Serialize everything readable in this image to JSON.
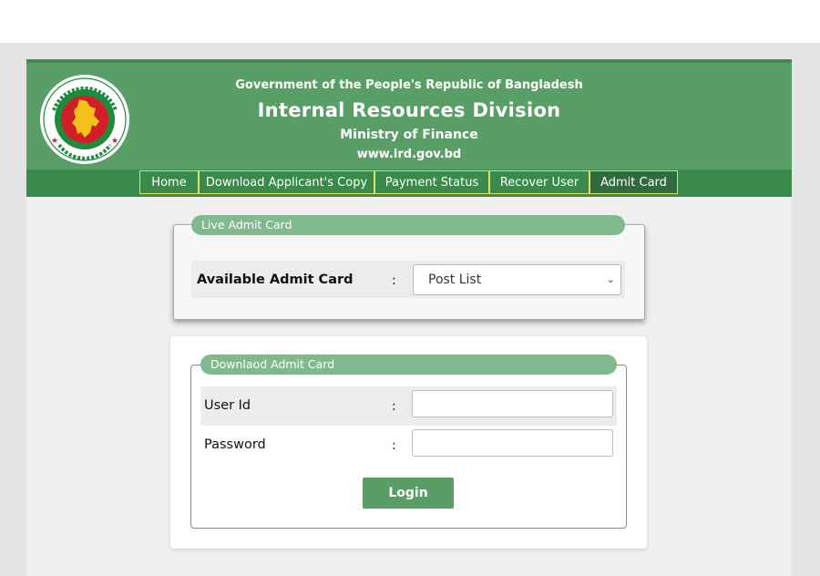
{
  "header": {
    "line1": "Government of the People's Republic of Bangladesh",
    "title": "Internal Resources Division",
    "ministry": "Ministry of Finance",
    "website": "www.ird.gov.bd"
  },
  "nav": {
    "items": [
      {
        "label": "Home"
      },
      {
        "label": "Download Applicant's Copy"
      },
      {
        "label": "Payment Status"
      },
      {
        "label": "Recover User"
      },
      {
        "label": "Admit Card",
        "active": true
      }
    ]
  },
  "live_admit": {
    "legend": "Live Admit Card",
    "field_label": "Available Admit Card",
    "colon": ":",
    "select_value": "Post List"
  },
  "download_admit": {
    "legend": "Downlaod Admit Card",
    "user_id_label": "User Id",
    "password_label": "Password",
    "colon": ":",
    "user_id_value": "",
    "password_value": "",
    "login_label": "Login"
  },
  "colors": {
    "header_green": "#5a9e67",
    "nav_green": "#3a8a4b",
    "legend_green": "#7fb98d",
    "nav_border": "#e3e060",
    "seal_red": "#d21f26",
    "seal_green": "#1f8a3c"
  },
  "icons": {
    "logo": "bangladesh-government-seal-icon",
    "select": "chevron-down-icon"
  }
}
